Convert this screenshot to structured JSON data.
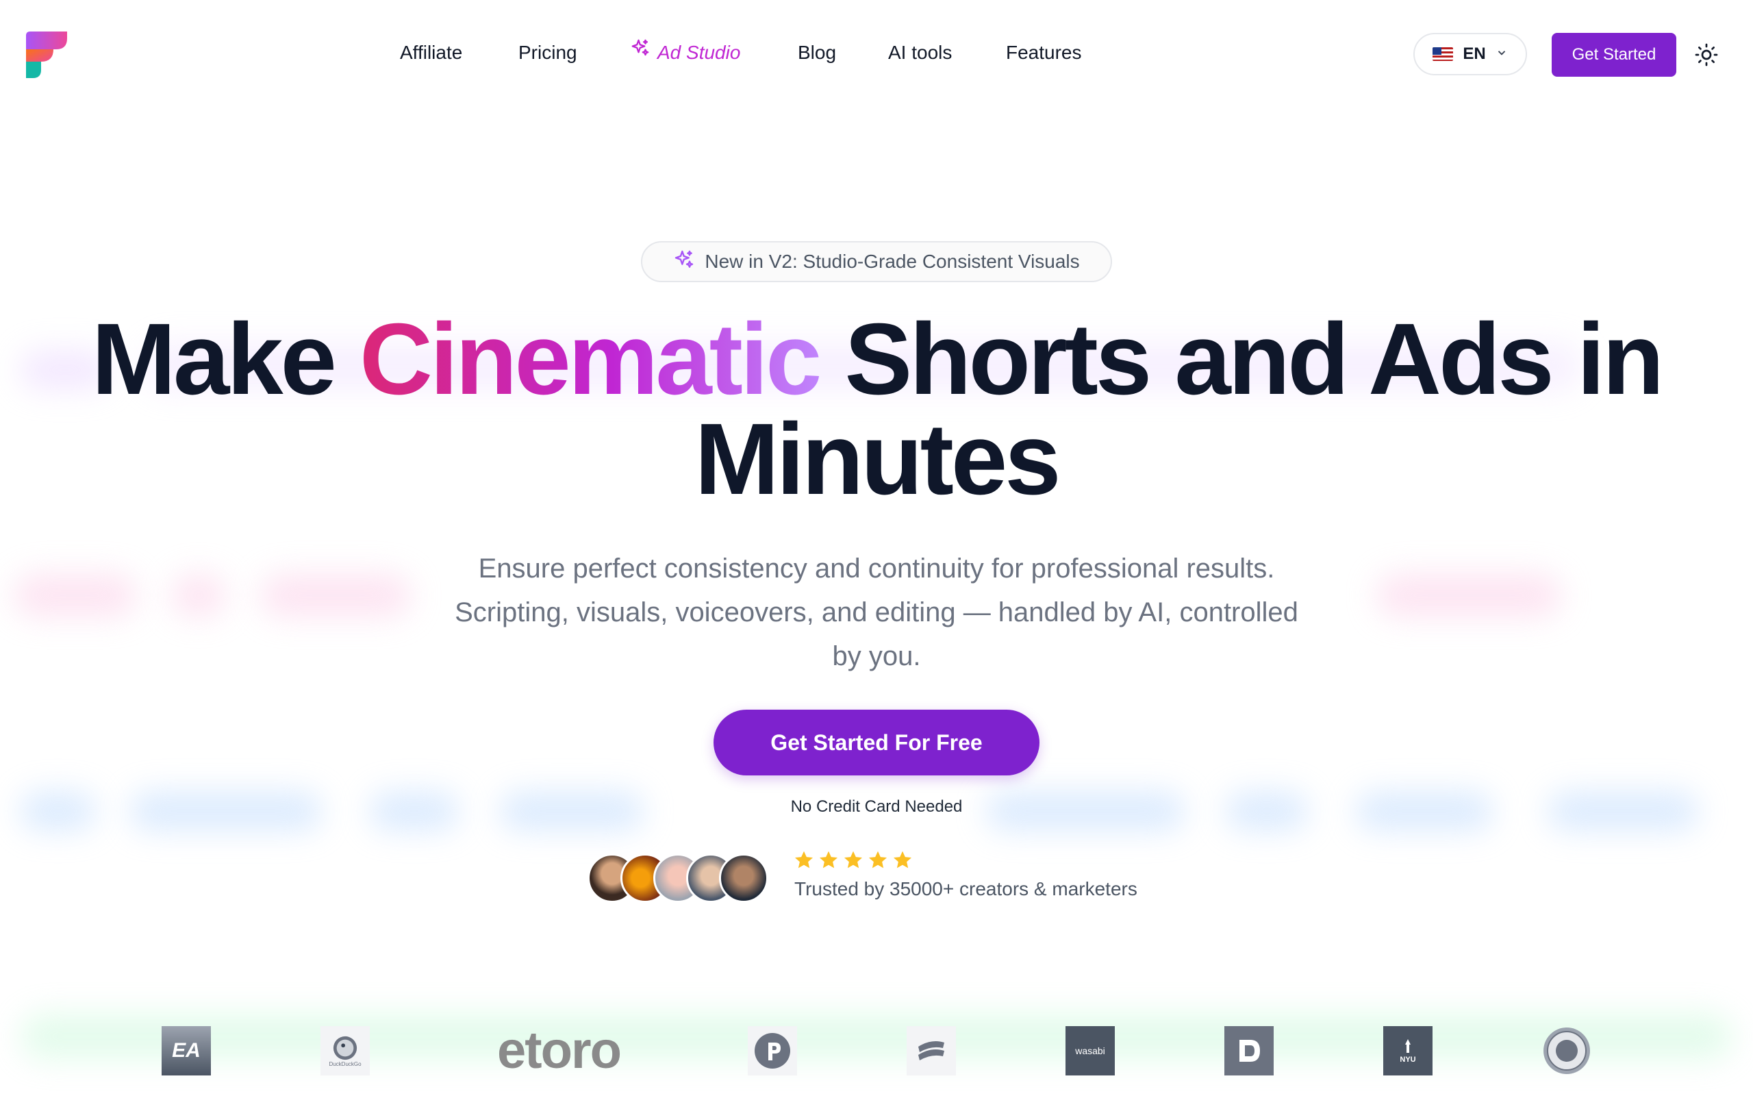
{
  "nav": {
    "items": [
      {
        "label": "Affiliate"
      },
      {
        "label": "Pricing"
      },
      {
        "label": "Ad Studio"
      },
      {
        "label": "Blog"
      },
      {
        "label": "AI tools"
      },
      {
        "label": "Features"
      }
    ]
  },
  "header": {
    "language": "EN",
    "cta_label": "Get Started"
  },
  "hero": {
    "badge_text": "New in V2: Studio-Grade Consistent Visuals",
    "headline": {
      "part1": "Make ",
      "highlight": "Cinematic",
      "part2": " Shorts and Ads in",
      "line2": "Minutes"
    },
    "subtext_line1": "Ensure perfect consistency and continuity for professional results.",
    "subtext_line2": "Scripting, visuals, voiceovers, and editing — handled by AI, controlled",
    "subtext_line3": "by you.",
    "cta_label": "Get Started For Free",
    "cta_note": "No Credit Card Needed",
    "rating_stars": 5,
    "trusted_text": "Trusted by 35000+ creators & marketers"
  },
  "logos": {
    "ea": "EA",
    "duckduckgo": "DuckDuckGo",
    "etoro": "etoro",
    "wasabi": "wasabi",
    "nyu": "NYU"
  },
  "colors": {
    "primary": "#7e22ce",
    "highlight_start": "#db2777",
    "highlight_end": "#c084fc",
    "star": "#fbbf24"
  }
}
